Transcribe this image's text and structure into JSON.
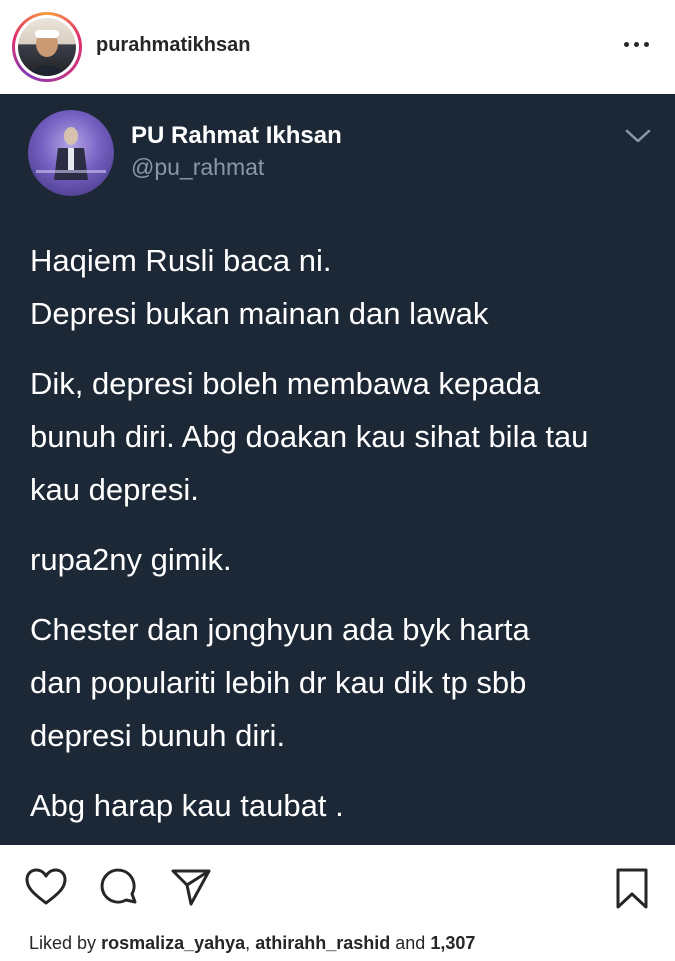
{
  "header": {
    "username": "purahmatikhsan",
    "more_icon": "more-horizontal-icon"
  },
  "tweet": {
    "display_name": "PU Rahmat Ikhsan",
    "handle": "@pu_rahmat",
    "paragraphs": [
      "Haqiem Rusli baca ni.\nDepresi bukan mainan dan lawak",
      "Dik, depresi boleh membawa kepada\nbunuh diri. Abg doakan kau sihat bila tau\nkau depresi.",
      "rupa2ny gimik.",
      "Chester dan jonghyun ada byk harta\ndan populariti lebih dr kau dik tp sbb\ndepresi bunuh diri.",
      "Abg harap kau taubat ."
    ],
    "colors": {
      "background": "#1c2836",
      "text": "#ffffff",
      "muted": "#8899a6"
    }
  },
  "actions": {
    "icons": [
      "heart-icon",
      "comment-icon",
      "share-icon",
      "bookmark-icon"
    ]
  },
  "likes": {
    "prefix": "Liked by",
    "user1": "rosmaliza_yahya",
    "separator": ",",
    "user2": "athirahh_rashid",
    "connector": "and",
    "count": "1,307"
  }
}
